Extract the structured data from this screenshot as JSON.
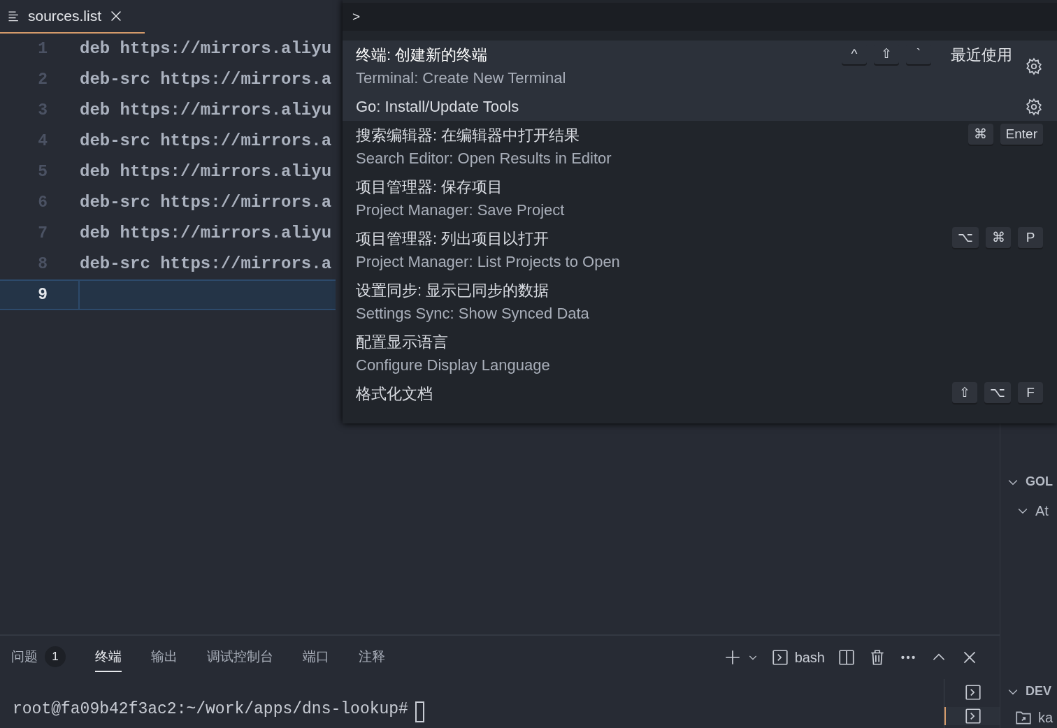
{
  "editor": {
    "tab": {
      "title": "sources.list",
      "active": true
    },
    "lines": [
      {
        "number": "1",
        "code": "deb https://mirrors.aliyu",
        "current": false
      },
      {
        "number": "2",
        "code": "deb-src https://mirrors.a",
        "current": false
      },
      {
        "number": "3",
        "code": "deb https://mirrors.aliyu",
        "current": false
      },
      {
        "number": "4",
        "code": "deb-src https://mirrors.a",
        "current": false
      },
      {
        "number": "5",
        "code": "deb https://mirrors.aliyu",
        "current": false
      },
      {
        "number": "6",
        "code": "deb-src https://mirrors.a",
        "current": false
      },
      {
        "number": "7",
        "code": "deb https://mirrors.aliyu",
        "current": false
      },
      {
        "number": "8",
        "code": "deb-src https://mirrors.a",
        "current": false
      },
      {
        "number": "9",
        "current": true
      }
    ]
  },
  "command_palette": {
    "input": ">",
    "items": [
      {
        "title": "终端: 创建新的终端",
        "subtitle": "Terminal: Create New Terminal",
        "keys": [
          "^",
          "⇧",
          "`"
        ],
        "tag": "最近使用",
        "gear": true,
        "selected": true
      },
      {
        "title": "Go: Install/Update Tools",
        "gear": true,
        "selected": false,
        "hovered": true
      },
      {
        "title": "搜索编辑器: 在编辑器中打开结果",
        "subtitle": "Search Editor: Open Results in Editor",
        "keys": [
          "⌘",
          "Enter"
        ],
        "selected": false
      },
      {
        "title": "项目管理器: 保存项目",
        "subtitle": "Project Manager: Save Project",
        "selected": false
      },
      {
        "title": "项目管理器: 列出项目以打开",
        "subtitle": "Project Manager: List Projects to Open",
        "keys": [
          "⌥",
          "⌘",
          "P"
        ],
        "selected": false
      },
      {
        "title": "设置同步: 显示已同步的数据",
        "subtitle": "Settings Sync: Show Synced Data",
        "selected": false
      },
      {
        "title": "配置显示语言",
        "subtitle": "Configure Display Language",
        "selected": false
      },
      {
        "title": "格式化文档",
        "keys": [
          "⇧",
          "⌥",
          "F"
        ],
        "selected": false
      }
    ]
  },
  "panel": {
    "tabs": [
      {
        "label": "问题",
        "badge": "1",
        "selected": false
      },
      {
        "label": "终端",
        "selected": true
      },
      {
        "label": "输出",
        "selected": false
      },
      {
        "label": "调试控制台",
        "selected": false
      },
      {
        "label": "端口",
        "selected": false
      },
      {
        "label": "注释",
        "selected": false
      }
    ],
    "terminal_name": "bash",
    "terminal_line": "root@fa09b42f3ac2:~/work/apps/dns-lookup#",
    "terminals": [
      {
        "selected": false
      },
      {
        "selected": true
      }
    ]
  },
  "sidebar": {
    "items": [
      {
        "kind": "section",
        "label": "GOL",
        "expanded": true
      },
      {
        "kind": "item",
        "label": "At",
        "expanded": true
      },
      {
        "kind": "section",
        "label": "DEV",
        "expanded": true
      },
      {
        "kind": "folder",
        "label": "ka"
      }
    ]
  }
}
